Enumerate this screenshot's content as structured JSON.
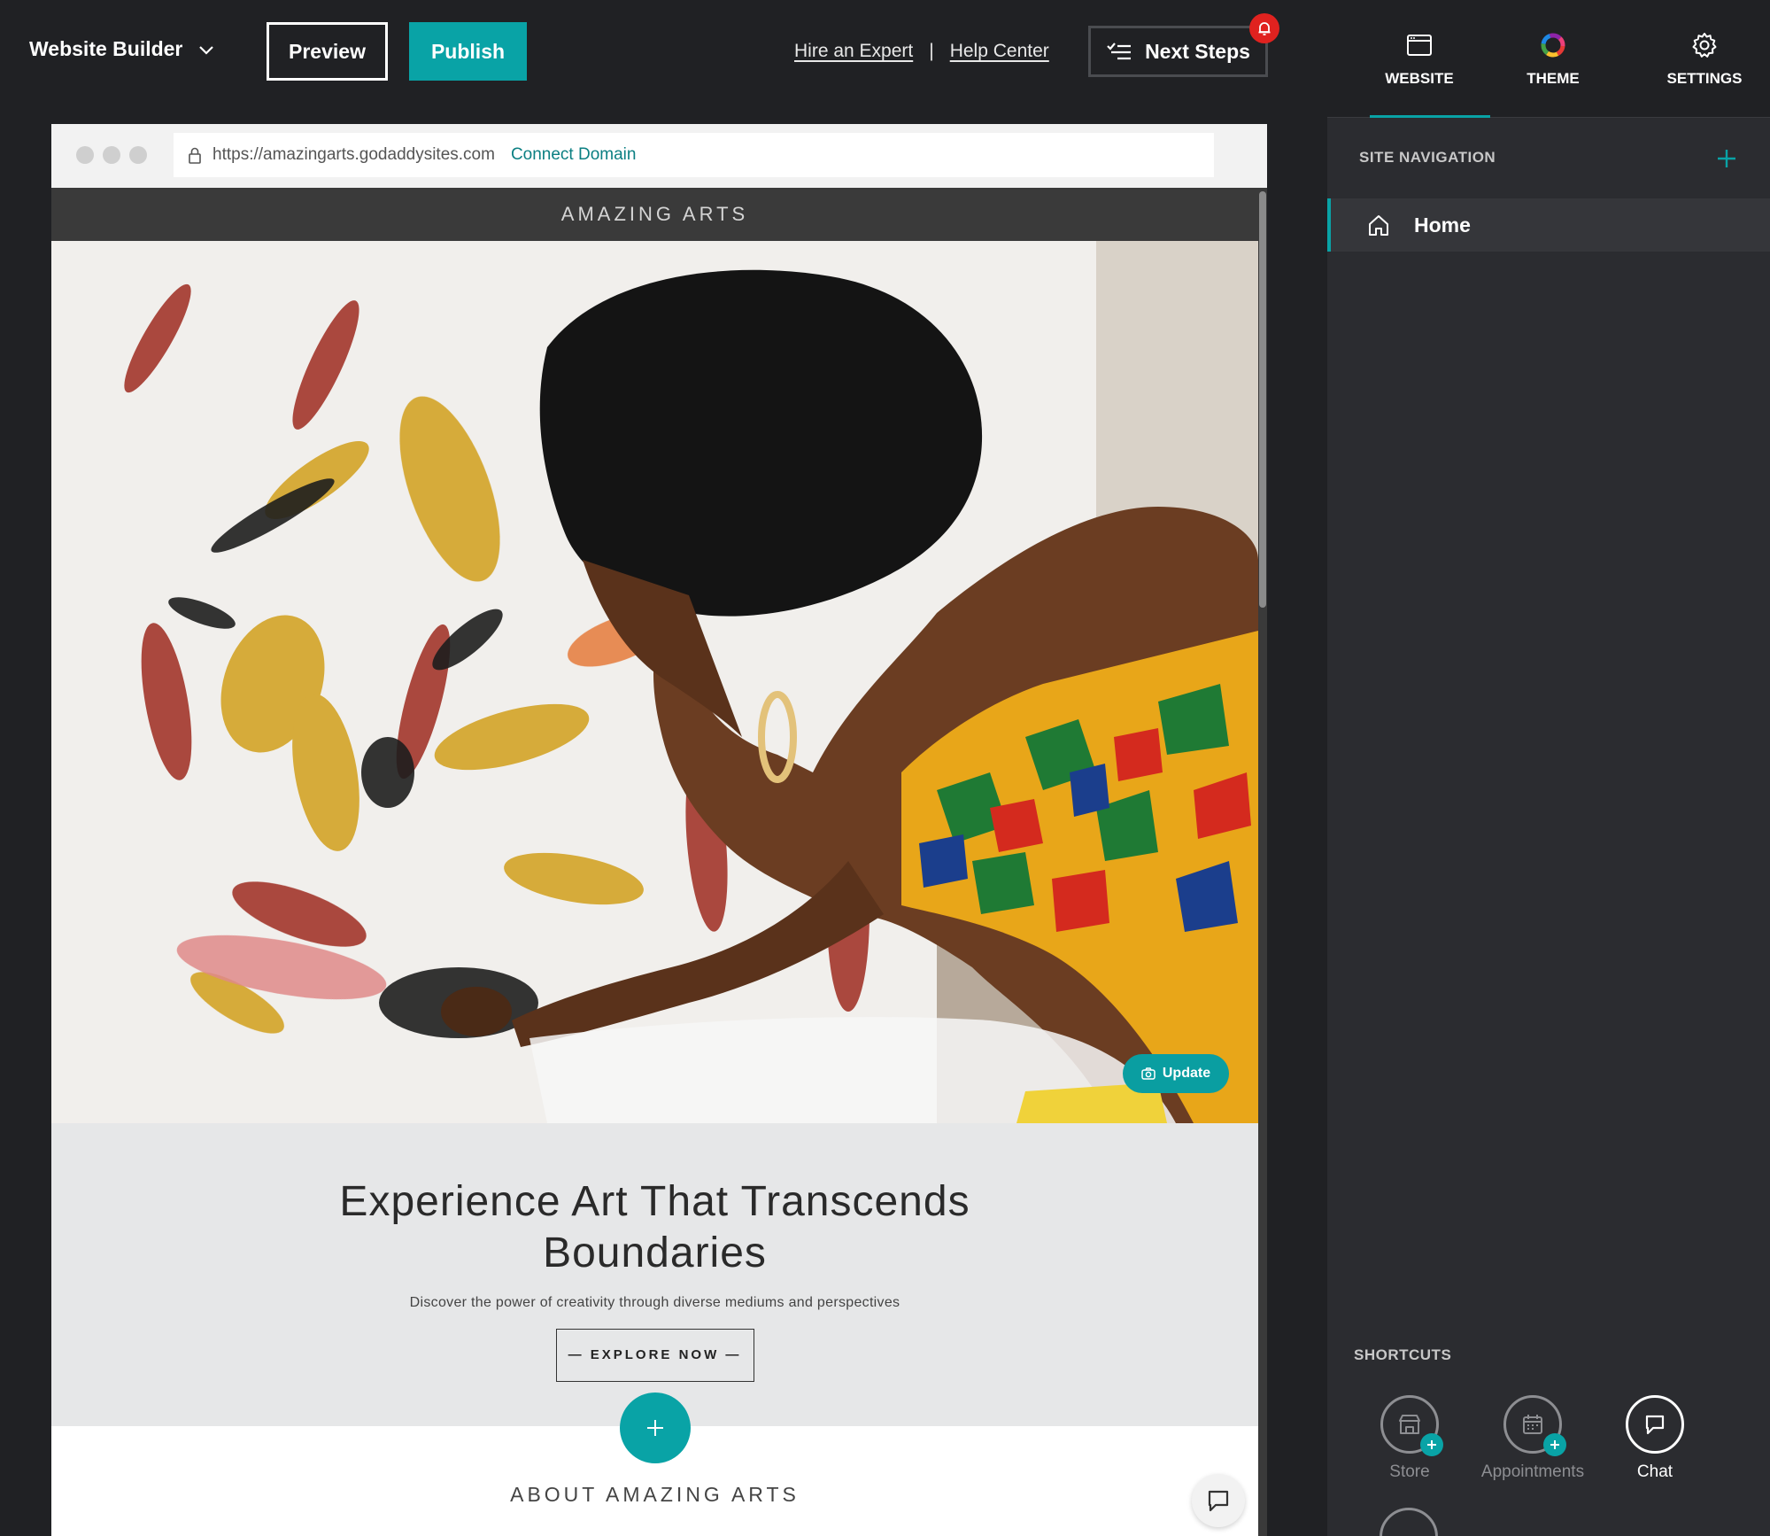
{
  "topbar": {
    "brand": "Website Builder",
    "preview_label": "Preview",
    "publish_label": "Publish",
    "hire_expert": "Hire an Expert",
    "separator": "|",
    "help_center": "Help Center",
    "next_steps": "Next Steps"
  },
  "browser": {
    "url": "https://amazingarts.godaddysites.com",
    "connect_domain": "Connect Domain"
  },
  "site": {
    "header_title": "AMAZING ARTS",
    "update_label": "Update",
    "headline_line1": "Experience Art That Transcends",
    "headline_line2": "Boundaries",
    "subline": "Discover the power of creativity through diverse mediums and perspectives",
    "cta": "— EXPLORE NOW —",
    "about_title": "ABOUT AMAZING ARTS"
  },
  "panel": {
    "tabs": [
      {
        "label": "WEBSITE",
        "icon": "browser-window-icon"
      },
      {
        "label": "THEME",
        "icon": "color-wheel-icon"
      },
      {
        "label": "SETTINGS",
        "icon": "gear-icon"
      }
    ],
    "site_navigation": "SITE NAVIGATION",
    "nav_items": [
      {
        "label": "Home",
        "icon": "home-icon"
      }
    ],
    "shortcuts_title": "SHORTCUTS",
    "shortcuts": [
      {
        "label": "Store",
        "icon": "store-icon"
      },
      {
        "label": "Appointments",
        "icon": "calendar-icon"
      },
      {
        "label": "Chat",
        "icon": "chat-icon"
      }
    ]
  },
  "colors": {
    "accent": "#09a3a6",
    "background": "#202124",
    "panel": "#2b2c30",
    "badge": "#e0221f"
  }
}
